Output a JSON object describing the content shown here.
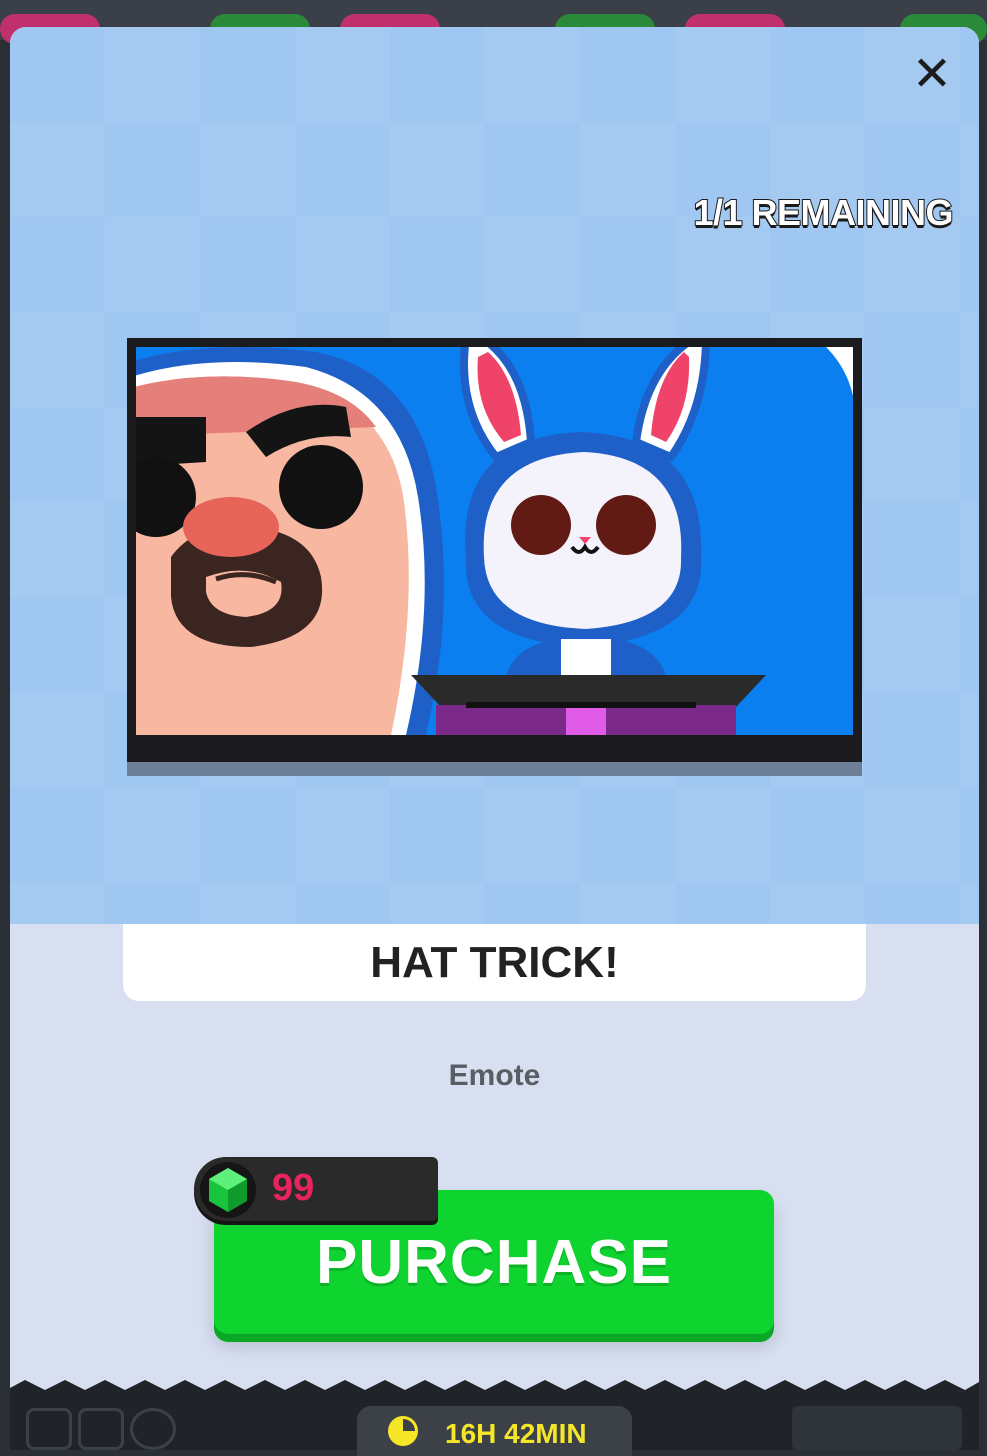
{
  "modal": {
    "close_label": "✕",
    "remaining": "1/1 REMAINING",
    "item_name": "HAT TRICK!",
    "item_type": "Emote",
    "price": "99",
    "purchase_label": "PURCHASE"
  },
  "footer": {
    "timer": "16H 42MIN"
  },
  "colors": {
    "top_background": "#9fc7f1",
    "purchase_green": "#0fd32e",
    "price_red": "#e8245c",
    "gem_green": "#17c43c",
    "timer_yellow": "#f5e627"
  },
  "icons": [
    "close-icon",
    "gem-icon",
    "clock-icon"
  ]
}
